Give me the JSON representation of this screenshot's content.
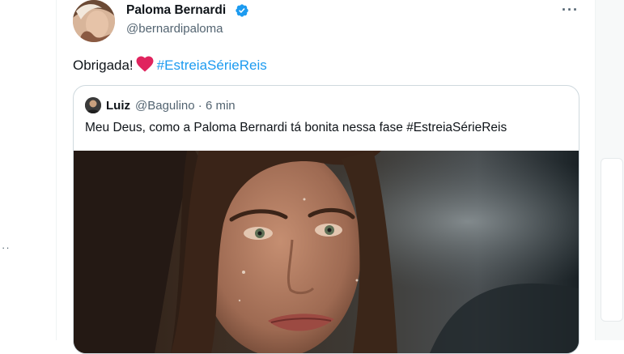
{
  "tweet": {
    "author_name": "Paloma Bernardi",
    "author_handle": "@bernardipaloma",
    "text_before": "Obrigada!",
    "heart_emoji": "red-heart",
    "hashtag": "#EstreiaSérieReis",
    "more_label": "···"
  },
  "quote": {
    "author_name": "Luiz",
    "author_handle": "@Bagulino · 6 min",
    "text": "Meu Deus, como a Paloma Bernardi tá bonita nessa fase #EstreiaSérieReis"
  },
  "left_panel": {
    "ellipsis": "··"
  },
  "colors": {
    "accent": "#1d9bf0",
    "verified": "#1d9bf0",
    "heart": "#e0245e",
    "text": "#0f1419",
    "secondary_text": "#536471",
    "border": "#cfd9de"
  }
}
